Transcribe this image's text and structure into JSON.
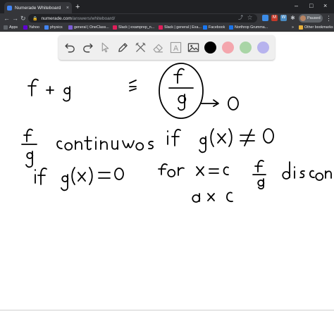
{
  "browser": {
    "tab_title": "Numerade Whiteboard",
    "tab_close": "×",
    "new_tab": "+",
    "window_controls": [
      "–",
      "□",
      "×"
    ],
    "nav": {
      "back": "←",
      "forward": "→",
      "reload": "↻"
    },
    "url_host": "numerade.com",
    "url_path": "/answers/whiteboard/",
    "lock": "🔒",
    "omnibox_tools": "⤴ ☆",
    "extensions": [
      {
        "label": "",
        "color": "#3c8ce7"
      },
      {
        "label": "M",
        "color": "#c53929"
      },
      {
        "label": "W",
        "color": "#4a8bc2"
      }
    ],
    "profile_status": "Paused",
    "menu": "⋮",
    "bookmarks": [
      {
        "label": "Apps",
        "icon": "apps-grid-icon",
        "color": "#5f6368"
      },
      {
        "label": "Yahoo",
        "icon": "yahoo-icon",
        "color": "#6001d2"
      },
      {
        "label": "physics",
        "icon": "physics-icon",
        "color": "#4285f4"
      },
      {
        "label": "general | OneClass...",
        "icon": "oneclass-icon",
        "color": "#7b5cd8"
      },
      {
        "label": "Slack | examprep_n...",
        "icon": "slack-icon",
        "color": "#e01e5a"
      },
      {
        "label": "Slack | general | Exa...",
        "icon": "slack-icon",
        "color": "#e01e5a"
      },
      {
        "label": "Facebook",
        "icon": "facebook-icon",
        "color": "#1877f2"
      },
      {
        "label": "Northrop Grumma...",
        "icon": "northrop-icon",
        "color": "#1a73e8"
      }
    ],
    "bookmarks_more": "»",
    "other_bookmarks": "Other bookmarks"
  },
  "whiteboard": {
    "tools": [
      {
        "name": "undo-icon"
      },
      {
        "name": "redo-icon"
      },
      {
        "name": "select-cursor-icon"
      },
      {
        "name": "pen-icon"
      },
      {
        "name": "tools-icon"
      },
      {
        "name": "eraser-icon"
      },
      {
        "name": "text-icon",
        "label": "A"
      },
      {
        "name": "image-icon"
      }
    ],
    "colors": [
      "#000000",
      "#f4a6ad",
      "#a9d5a6",
      "#b7b3ee"
    ],
    "handwriting": [
      {
        "name": "f-plus-g",
        "text": "f + g"
      },
      {
        "name": "colon",
        "text": ":"
      },
      {
        "name": "f-over-g-circled",
        "text": "f / g"
      },
      {
        "name": "arrow-to-0",
        "text": "→ 0"
      },
      {
        "name": "f-over-g-continuous",
        "text": "f / g continuous"
      },
      {
        "name": "if-g-x-not-0",
        "text": "if g(x) ≠ 0"
      },
      {
        "name": "if-g-x-eq-0",
        "text": "if g(x) = 0"
      },
      {
        "name": "for-x-eq-c",
        "text": "for x = c"
      },
      {
        "name": "f-over-g-discont",
        "text": "f / g discont."
      },
      {
        "name": "at-c",
        "text": "at c"
      }
    ]
  }
}
